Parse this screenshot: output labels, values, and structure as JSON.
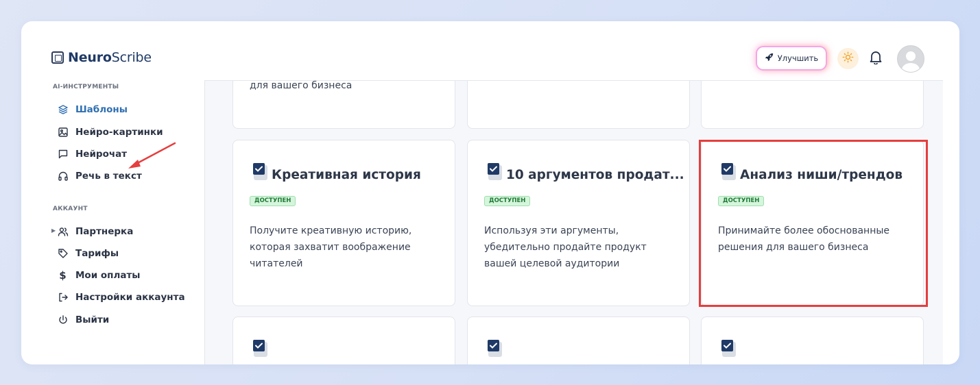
{
  "app": {
    "logo_bold": "Neuro",
    "logo_rest": "Scribe"
  },
  "header": {
    "upgrade_label": "Улучшить"
  },
  "sidebar": {
    "section_ai": "AI-ИНСТРУМЕНТЫ",
    "ai_items": [
      {
        "label": "Шаблоны",
        "icon": "layers-icon"
      },
      {
        "label": "Нейро-картинки",
        "icon": "image-icon"
      },
      {
        "label": "Нейрочат",
        "icon": "chat-icon"
      },
      {
        "label": "Речь в текст",
        "icon": "headphones-icon"
      }
    ],
    "section_account": "АККАУНТ",
    "account_items": [
      {
        "label": "Партнерка",
        "icon": "users-icon"
      },
      {
        "label": "Тарифы",
        "icon": "tag-icon"
      },
      {
        "label": "Мои оплаты",
        "icon": "dollar-icon"
      },
      {
        "label": "Настройки аккаунта",
        "icon": "login-icon"
      },
      {
        "label": "Выйти",
        "icon": "power-icon"
      }
    ]
  },
  "cards_top": [
    {
      "desc": "для вашего бизнеса"
    },
    {
      "desc": ""
    },
    {
      "desc": ""
    }
  ],
  "cards": [
    {
      "title": "Креативная история",
      "badge": "ДОСТУПЕН",
      "desc": "Получите креативную историю, которая захватит воображение читателей"
    },
    {
      "title": "10 аргументов продат...",
      "badge": "ДОСТУПЕН",
      "desc": "Используя эти аргументы, убедительно продайте продукт вашей целевой аудитории"
    },
    {
      "title": "Анализ ниши/трендов",
      "badge": "ДОСТУПЕН",
      "desc": "Принимайте более обоснованные решения для вашего бизнеса"
    }
  ],
  "colors": {
    "accent": "#2f6fb3",
    "highlight": "#e53e3e",
    "badge_bg": "#d6f5dc"
  }
}
